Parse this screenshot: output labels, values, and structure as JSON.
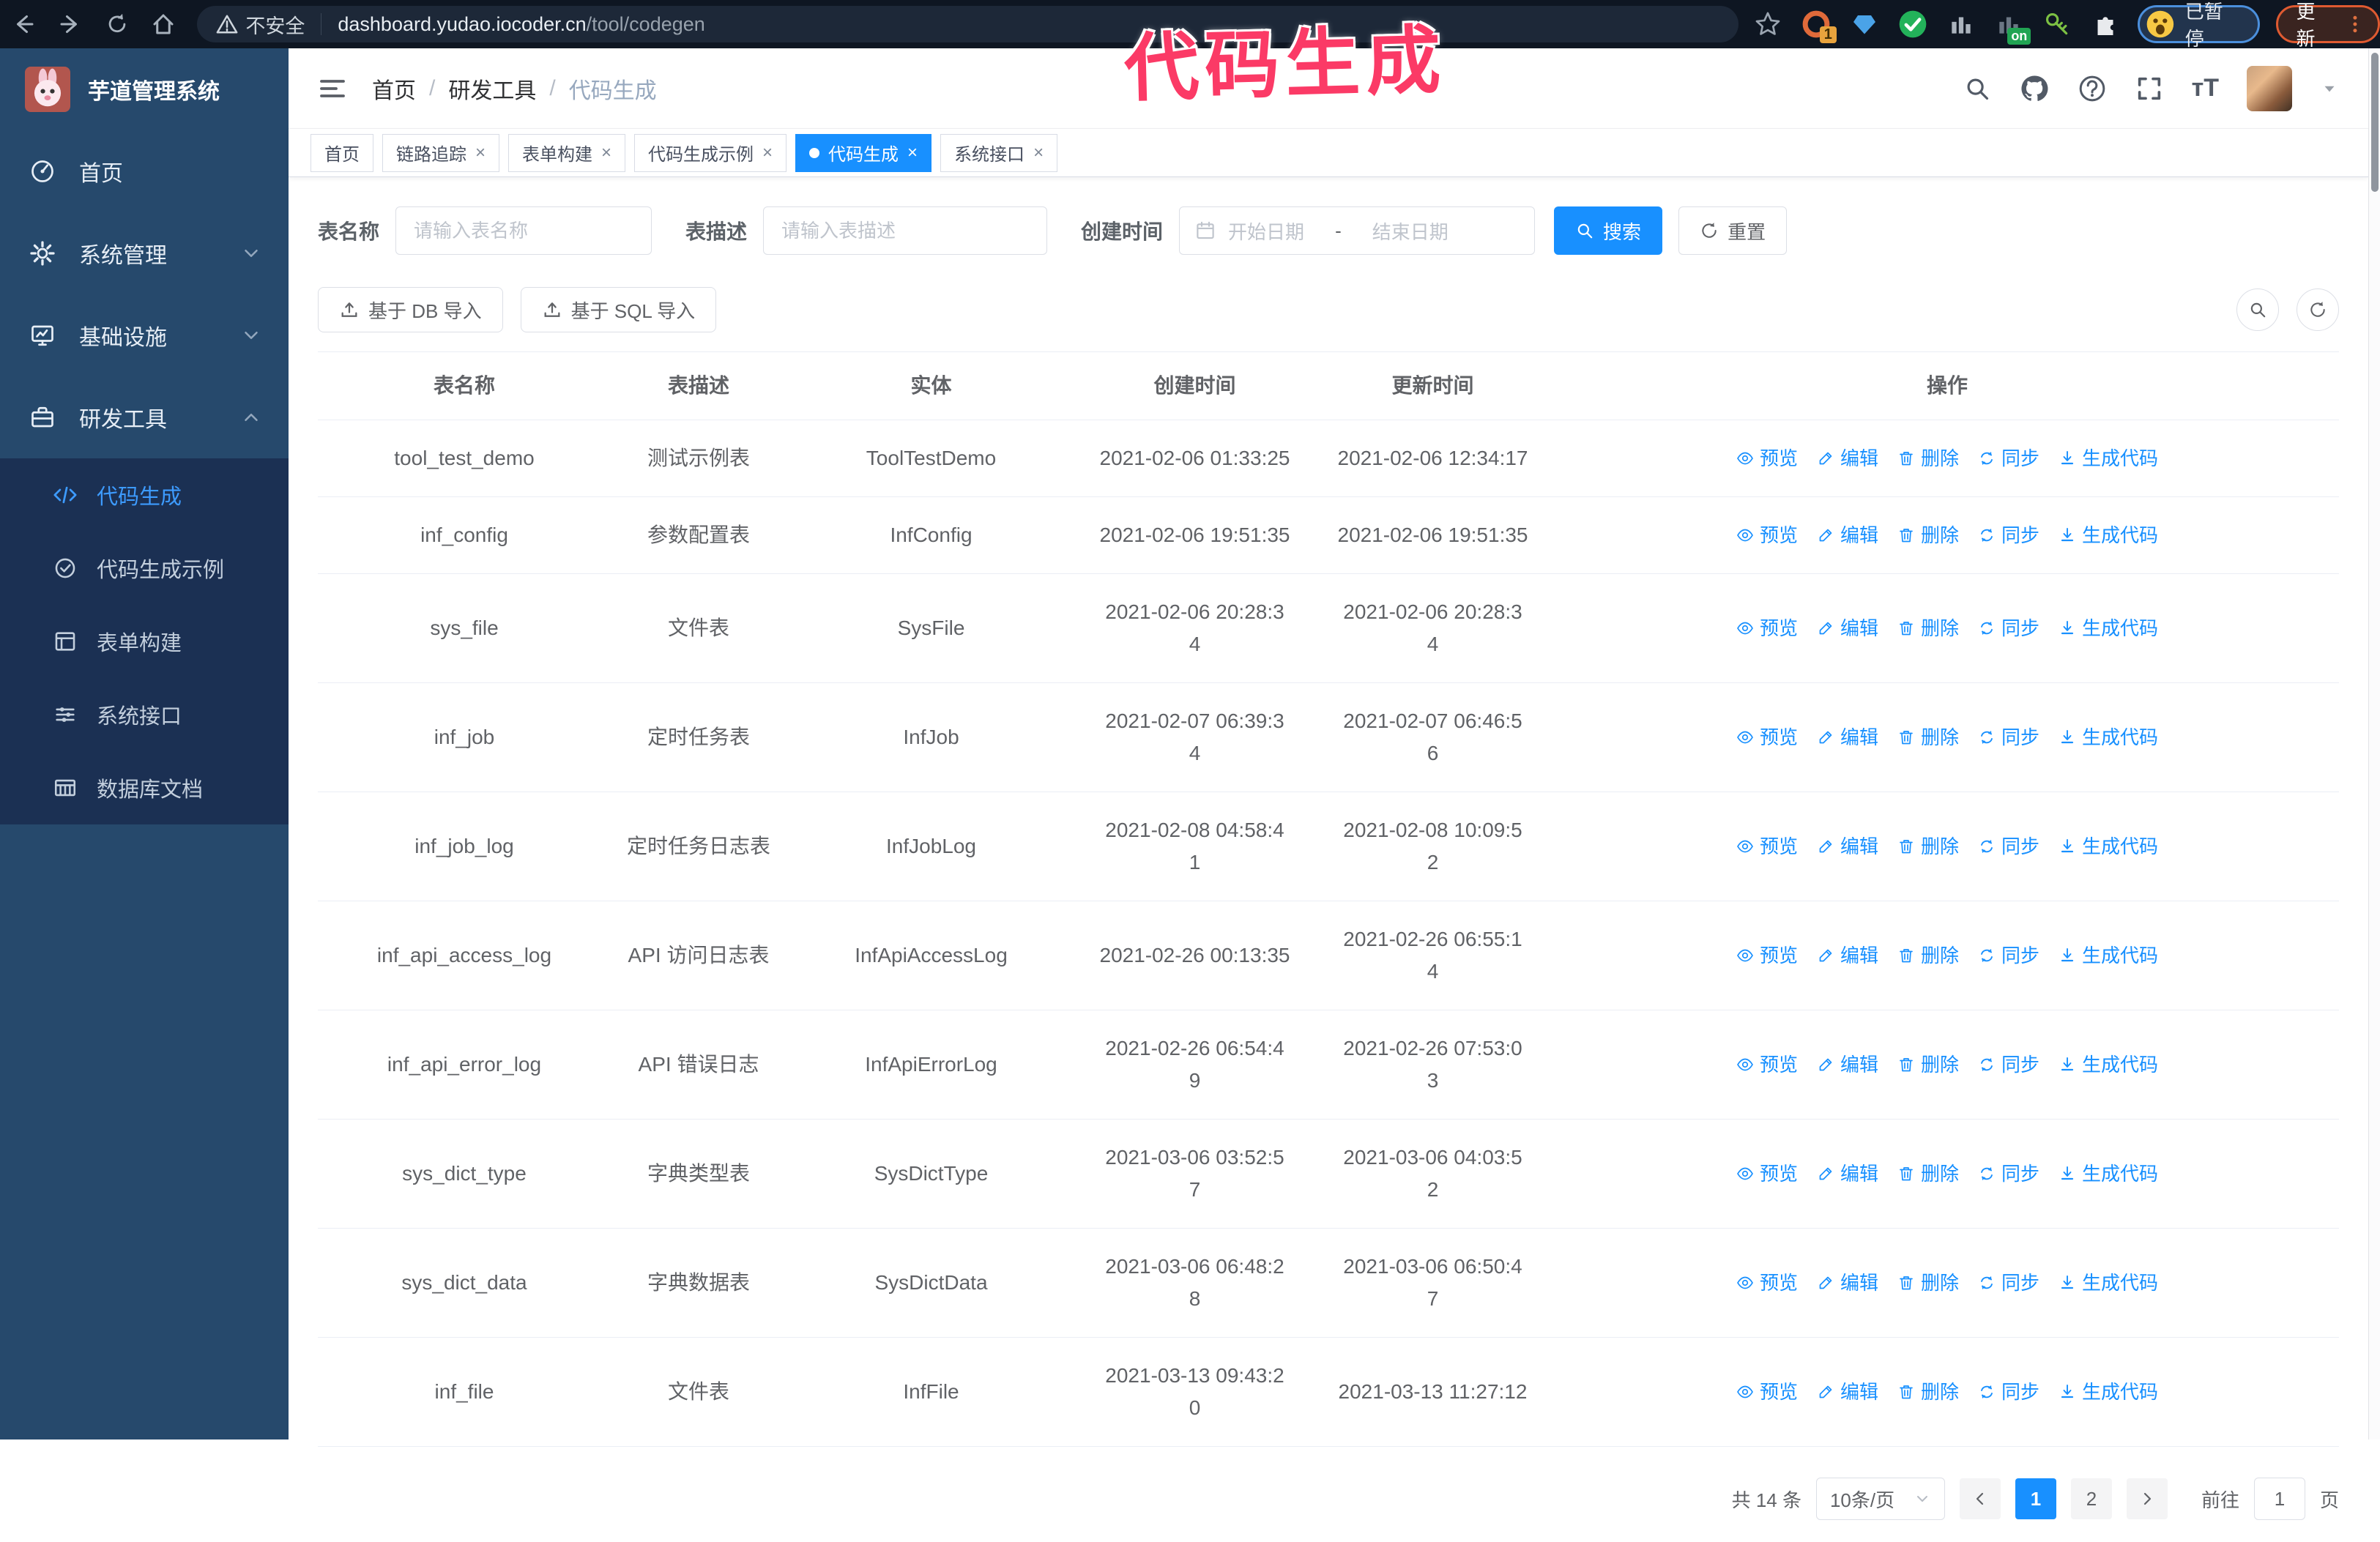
{
  "browser": {
    "security_label": "不安全",
    "url_host": "dashboard.yudao.iocoder.cn",
    "url_path": "/tool/codegen",
    "extension_badge": "1",
    "extension_on_badge": "on",
    "profile_label": "已暂停",
    "update_label": "更新"
  },
  "annotation": {
    "text": "代码生成",
    "color": "#fb3a66"
  },
  "sidebar": {
    "logo_title": "芋道管理系统",
    "items": [
      {
        "label": "首页"
      },
      {
        "label": "系统管理"
      },
      {
        "label": "基础设施"
      },
      {
        "label": "研发工具"
      }
    ],
    "subitems": [
      {
        "label": "代码生成"
      },
      {
        "label": "代码生成示例"
      },
      {
        "label": "表单构建"
      },
      {
        "label": "系统接口"
      },
      {
        "label": "数据库文档"
      }
    ]
  },
  "header": {
    "breadcrumb": {
      "home": "首页",
      "group": "研发工具",
      "current": "代码生成"
    }
  },
  "tabs": [
    {
      "label": "首页"
    },
    {
      "label": "链路追踪"
    },
    {
      "label": "表单构建"
    },
    {
      "label": "代码生成示例"
    },
    {
      "label": "代码生成"
    },
    {
      "label": "系统接口"
    }
  ],
  "filters": {
    "table_name_label": "表名称",
    "table_name_placeholder": "请输入表名称",
    "table_desc_label": "表描述",
    "table_desc_placeholder": "请输入表描述",
    "create_time_label": "创建时间",
    "date_start_placeholder": "开始日期",
    "date_separator": "-",
    "date_end_placeholder": "结束日期",
    "search_label": "搜索",
    "reset_label": "重置"
  },
  "toolbar": {
    "db_import_label": "基于 DB 导入",
    "sql_import_label": "基于 SQL 导入"
  },
  "table": {
    "columns": [
      "表名称",
      "表描述",
      "实体",
      "创建时间",
      "更新时间",
      "操作"
    ],
    "action_labels": [
      "预览",
      "编辑",
      "删除",
      "同步",
      "生成代码"
    ],
    "rows": [
      {
        "name": "tool_test_demo",
        "desc": "测试示例表",
        "entity": "ToolTestDemo",
        "created": "2021-02-06 01:33:25",
        "updated": "2021-02-06 12:34:17"
      },
      {
        "name": "inf_config",
        "desc": "参数配置表",
        "entity": "InfConfig",
        "created": "2021-02-06 19:51:35",
        "updated": "2021-02-06 19:51:35"
      },
      {
        "name": "sys_file",
        "desc": "文件表",
        "entity": "SysFile",
        "created": "2021-02-06 20:28:3\n4",
        "updated": "2021-02-06 20:28:3\n4"
      },
      {
        "name": "inf_job",
        "desc": "定时任务表",
        "entity": "InfJob",
        "created": "2021-02-07 06:39:3\n4",
        "updated": "2021-02-07 06:46:5\n6"
      },
      {
        "name": "inf_job_log",
        "desc": "定时任务日志表",
        "entity": "InfJobLog",
        "created": "2021-02-08 04:58:4\n1",
        "updated": "2021-02-08 10:09:5\n2"
      },
      {
        "name": "inf_api_access_log",
        "desc": "API 访问日志表",
        "entity": "InfApiAccessLog",
        "created": "2021-02-26 00:13:35",
        "updated": "2021-02-26 06:55:1\n4"
      },
      {
        "name": "inf_api_error_log",
        "desc": "API 错误日志",
        "entity": "InfApiErrorLog",
        "created": "2021-02-26 06:54:4\n9",
        "updated": "2021-02-26 07:53:0\n3"
      },
      {
        "name": "sys_dict_type",
        "desc": "字典类型表",
        "entity": "SysDictType",
        "created": "2021-03-06 03:52:5\n7",
        "updated": "2021-03-06 04:03:5\n2"
      },
      {
        "name": "sys_dict_data",
        "desc": "字典数据表",
        "entity": "SysDictData",
        "created": "2021-03-06 06:48:2\n8",
        "updated": "2021-03-06 06:50:4\n7"
      },
      {
        "name": "inf_file",
        "desc": "文件表",
        "entity": "InfFile",
        "created": "2021-03-13 09:43:2\n0",
        "updated": "2021-03-13 11:27:12"
      }
    ]
  },
  "pagination": {
    "total_label": "共 14 条",
    "page_size_label": "10条/页",
    "page_1": "1",
    "page_2": "2",
    "goto_label": "前往",
    "goto_value": "1",
    "goto_suffix": "页"
  }
}
